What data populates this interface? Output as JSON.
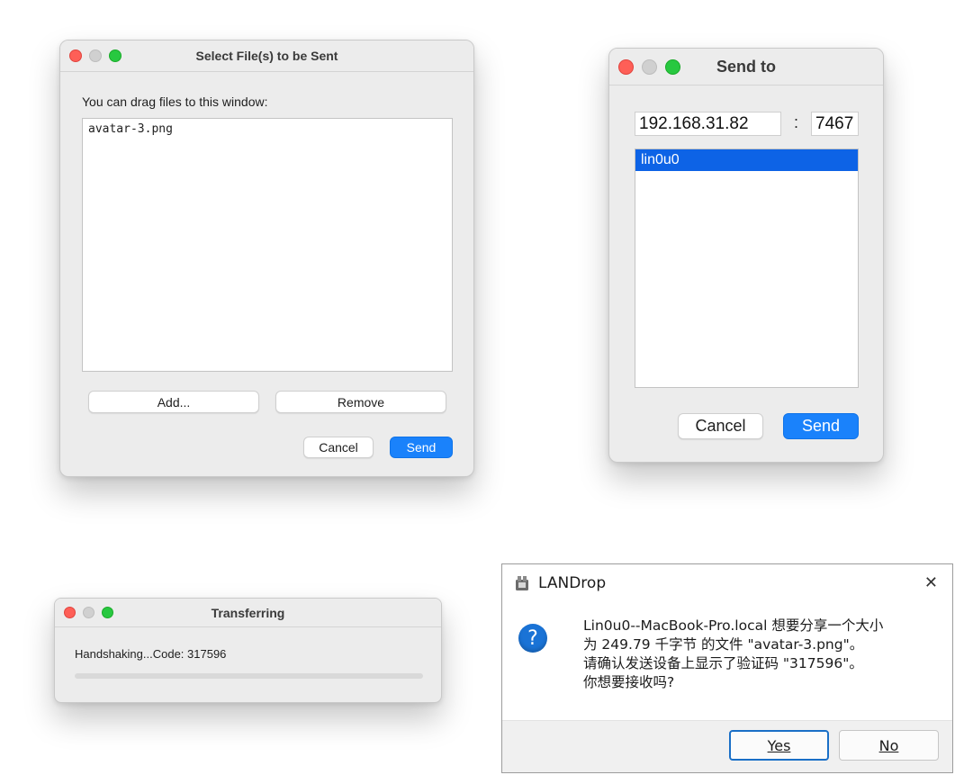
{
  "select_files": {
    "title": "Select File(s) to be Sent",
    "hint": "You can drag files to this window:",
    "files": [
      "avatar-3.png"
    ],
    "add_label": "Add...",
    "remove_label": "Remove",
    "cancel_label": "Cancel",
    "send_label": "Send"
  },
  "send_to": {
    "title": "Send to",
    "ip_value": "192.168.31.82",
    "separator": ":",
    "port_value": "7467",
    "devices": [
      "lin0u0"
    ],
    "cancel_label": "Cancel",
    "send_label": "Send"
  },
  "transferring": {
    "title": "Transferring",
    "status": "Handshaking...Code: 317596",
    "progress": 0
  },
  "landrop": {
    "app_name": "LANDrop",
    "close_glyph": "✕",
    "icon_glyph": "?",
    "message_lines": [
      "Lin0u0--MacBook-Pro.local 想要分享一个大小",
      "为 249.79 千字节 的文件 \"avatar-3.png\"。",
      "请确认发送设备上显示了验证码 \"317596\"。",
      "你想要接收吗?"
    ],
    "yes_label": "Yes",
    "no_label": "No"
  },
  "colors": {
    "accent": "#1a82fb",
    "selection": "#0d63e6",
    "traffic_red": "#fe5f57",
    "traffic_green": "#28c840",
    "question_icon": "#1a73d6"
  }
}
